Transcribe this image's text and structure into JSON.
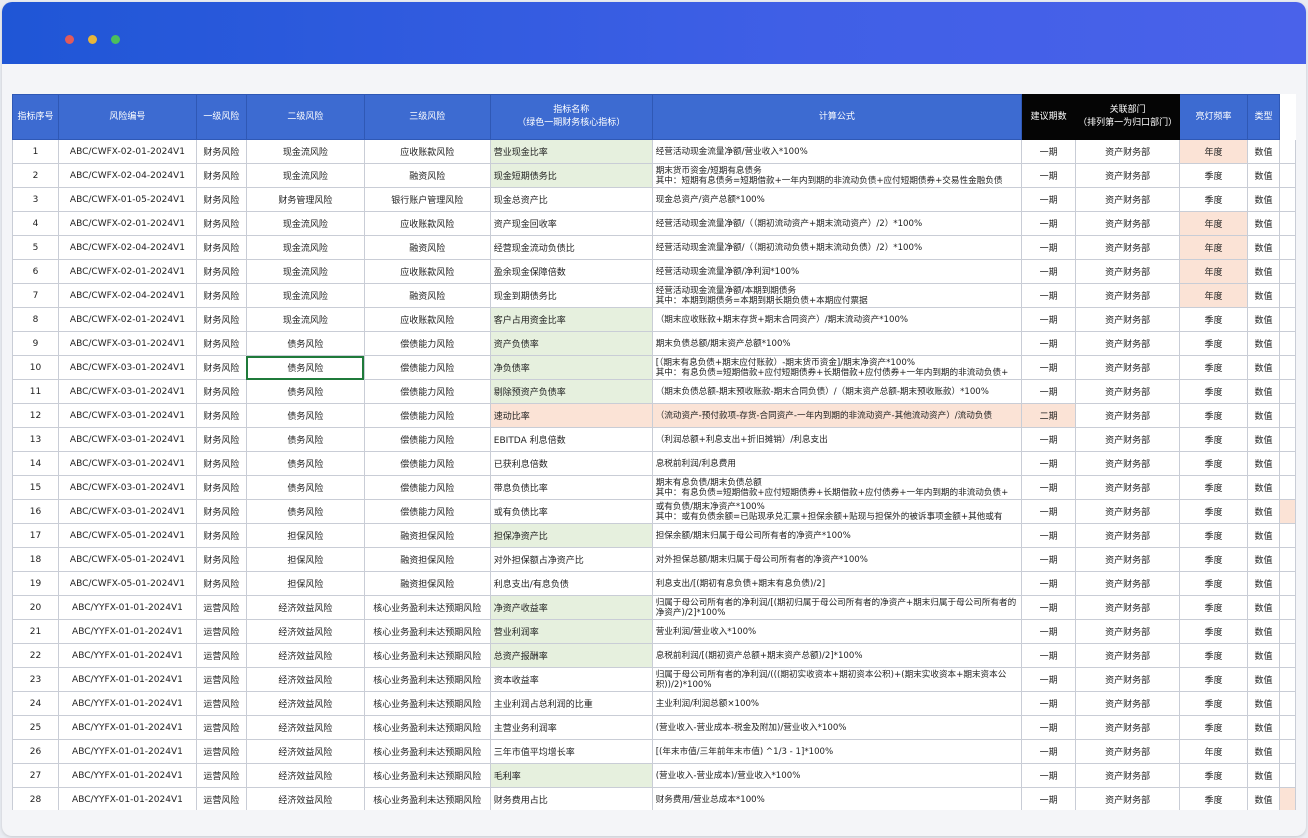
{
  "window": {
    "dots": [
      "#e25a5a",
      "#e8b53a",
      "#4bbf5c"
    ]
  },
  "headers": {
    "idx": "指标序号",
    "code": "风险编号",
    "l1": "一级风险",
    "l2": "二级风险",
    "l3": "三级风险",
    "name": "指标名称\n（绿色一期财务核心指标）",
    "formula": "计算公式",
    "period": "建议期数",
    "dept": "关联部门\n（排列第一为归口部门）",
    "freq": "亮灯频率",
    "type": "类型"
  },
  "rows": [
    {
      "idx": "1",
      "code": "ABC/CWFX-02-01-2024V1",
      "l1": "财务风险",
      "l2": "现金流风险",
      "l3": "应收账款风险",
      "name": "营业现金比率",
      "formula": "经营活动现金流量净额/营业收入*100%",
      "period": "一期",
      "dept": "资产财务部",
      "freq": "年度",
      "type": "数值",
      "green": true,
      "peach": true,
      "ext": false
    },
    {
      "idx": "2",
      "code": "ABC/CWFX-02-04-2024V1",
      "l1": "财务风险",
      "l2": "现金流风险",
      "l3": "融资风险",
      "name": "现金短期债务比",
      "formula": "期末货币资金/短期有息债务\n其中：短期有息债务=短期借款+一年内到期的非流动负债+应付短期债券+交易性金融负债",
      "period": "一期",
      "dept": "资产财务部",
      "freq": "季度",
      "type": "数值",
      "green": true,
      "peach": false,
      "ext": false
    },
    {
      "idx": "3",
      "code": "ABC/CWFX-01-05-2024V1",
      "l1": "财务风险",
      "l2": "财务管理风险",
      "l3": "银行账户管理风险",
      "name": "现金总资产比",
      "formula": "现金总资产/资产总额*100%",
      "period": "一期",
      "dept": "资产财务部",
      "freq": "季度",
      "type": "数值",
      "green": false,
      "peach": false,
      "ext": false
    },
    {
      "idx": "4",
      "code": "ABC/CWFX-02-01-2024V1",
      "l1": "财务风险",
      "l2": "现金流风险",
      "l3": "应收账款风险",
      "name": "资产现金回收率",
      "formula": "经营活动现金流量净额/（（期初流动资产+期末流动资产）/2）*100%",
      "period": "一期",
      "dept": "资产财务部",
      "freq": "年度",
      "type": "数值",
      "green": false,
      "peach": true,
      "ext": false
    },
    {
      "idx": "5",
      "code": "ABC/CWFX-02-04-2024V1",
      "l1": "财务风险",
      "l2": "现金流风险",
      "l3": "融资风险",
      "name": "经营现金流动负债比",
      "formula": "经营活动现金流量净额/（（期初流动负债+期末流动负债）/2）*100%",
      "period": "一期",
      "dept": "资产财务部",
      "freq": "年度",
      "type": "数值",
      "green": false,
      "peach": true,
      "ext": false
    },
    {
      "idx": "6",
      "code": "ABC/CWFX-02-01-2024V1",
      "l1": "财务风险",
      "l2": "现金流风险",
      "l3": "应收账款风险",
      "name": "盈余现金保障倍数",
      "formula": "经营活动现金流量净额/净利润*100%",
      "period": "一期",
      "dept": "资产财务部",
      "freq": "年度",
      "type": "数值",
      "green": false,
      "peach": true,
      "ext": false
    },
    {
      "idx": "7",
      "code": "ABC/CWFX-02-04-2024V1",
      "l1": "财务风险",
      "l2": "现金流风险",
      "l3": "融资风险",
      "name": "现金到期债务比",
      "formula": "经营活动现金流量净额/本期到期债务\n其中：本期到期债务=本期到期长期负债+本期应付票据",
      "period": "一期",
      "dept": "资产财务部",
      "freq": "年度",
      "type": "数值",
      "green": false,
      "peach": true,
      "ext": false
    },
    {
      "idx": "8",
      "code": "ABC/CWFX-02-01-2024V1",
      "l1": "财务风险",
      "l2": "现金流风险",
      "l3": "应收账款风险",
      "name": "客户占用资金比率",
      "formula": "（期末应收账款+期末存货+期末合同资产）/期末流动资产*100%",
      "period": "一期",
      "dept": "资产财务部",
      "freq": "季度",
      "type": "数值",
      "green": true,
      "peach": false,
      "ext": false
    },
    {
      "idx": "9",
      "code": "ABC/CWFX-03-01-2024V1",
      "l1": "财务风险",
      "l2": "债务风险",
      "l3": "偿债能力风险",
      "name": "资产负债率",
      "formula": "期末负债总额/期末资产总额*100%",
      "period": "一期",
      "dept": "资产财务部",
      "freq": "季度",
      "type": "数值",
      "green": true,
      "peach": false,
      "ext": false
    },
    {
      "idx": "10",
      "code": "ABC/CWFX-03-01-2024V1",
      "l1": "财务风险",
      "l2": "债务风险",
      "l3": "偿债能力风险",
      "name": "净负债率",
      "formula": "[（期末有息负债+期末应付账款）-期末货币资金]/期末净资产*100%\n其中：有息负债=短期借款+应付短期债券+长期借款+应付债券+一年内到期的非流动负债+",
      "period": "一期",
      "dept": "资产财务部",
      "freq": "季度",
      "type": "数值",
      "green": true,
      "peach": false,
      "ext": false,
      "sel": true
    },
    {
      "idx": "11",
      "code": "ABC/CWFX-03-01-2024V1",
      "l1": "财务风险",
      "l2": "债务风险",
      "l3": "偿债能力风险",
      "name": "剔除预资产负债率",
      "formula": "（期末负债总额-期末预收账款-期末合同负债）/（期末资产总额-期末预收账款）*100%",
      "period": "一期",
      "dept": "资产财务部",
      "freq": "季度",
      "type": "数值",
      "green": true,
      "peach": false,
      "ext": false
    },
    {
      "idx": "12",
      "code": "ABC/CWFX-03-01-2024V1",
      "l1": "财务风险",
      "l2": "债务风险",
      "l3": "偿债能力风险",
      "name": "速动比率",
      "formula": "（流动资产-预付款项-存货-合同资产-一年内到期的非流动资产-其他流动资产）/流动负债",
      "period": "二期",
      "dept": "资产财务部",
      "freq": "季度",
      "type": "数值",
      "green": false,
      "peach": false,
      "ext": false,
      "rowpeach": true
    },
    {
      "idx": "13",
      "code": "ABC/CWFX-03-01-2024V1",
      "l1": "财务风险",
      "l2": "债务风险",
      "l3": "偿债能力风险",
      "name": "EBITDA 利息倍数",
      "formula": "（利润总额+利息支出+折旧摊销）/利息支出",
      "period": "一期",
      "dept": "资产财务部",
      "freq": "季度",
      "type": "数值",
      "green": false,
      "peach": false,
      "ext": false
    },
    {
      "idx": "14",
      "code": "ABC/CWFX-03-01-2024V1",
      "l1": "财务风险",
      "l2": "债务风险",
      "l3": "偿债能力风险",
      "name": "已获利息倍数",
      "formula": "息税前利润/利息费用",
      "period": "一期",
      "dept": "资产财务部",
      "freq": "季度",
      "type": "数值",
      "green": false,
      "peach": false,
      "ext": false
    },
    {
      "idx": "15",
      "code": "ABC/CWFX-03-01-2024V1",
      "l1": "财务风险",
      "l2": "债务风险",
      "l3": "偿债能力风险",
      "name": "带息负债比率",
      "formula": "期末有息负债/期末负债总额\n其中：有息负债=短期借款+应付短期债券+长期借款+应付债券+一年内到期的非流动负债+",
      "period": "一期",
      "dept": "资产财务部",
      "freq": "季度",
      "type": "数值",
      "green": false,
      "peach": false,
      "ext": false
    },
    {
      "idx": "16",
      "code": "ABC/CWFX-03-01-2024V1",
      "l1": "财务风险",
      "l2": "债务风险",
      "l3": "偿债能力风险",
      "name": "或有负债比率",
      "formula": "或有负债/期末净资产*100%\n其中：或有负债余额=已贴现承兑汇票+担保余额+贴现与担保外的被诉事项金额+其他或有",
      "period": "一期",
      "dept": "资产财务部",
      "freq": "季度",
      "type": "数值",
      "green": false,
      "peach": false,
      "ext": true
    },
    {
      "idx": "17",
      "code": "ABC/CWFX-05-01-2024V1",
      "l1": "财务风险",
      "l2": "担保风险",
      "l3": "融资担保风险",
      "name": "担保净资产比",
      "formula": "担保余额/期末归属于母公司所有者的净资产*100%",
      "period": "一期",
      "dept": "资产财务部",
      "freq": "季度",
      "type": "数值",
      "green": true,
      "peach": false,
      "ext": false
    },
    {
      "idx": "18",
      "code": "ABC/CWFX-05-01-2024V1",
      "l1": "财务风险",
      "l2": "担保风险",
      "l3": "融资担保风险",
      "name": "对外担保额占净资产比",
      "formula": "对外担保总额/期末归属于母公司所有者的净资产*100%",
      "period": "一期",
      "dept": "资产财务部",
      "freq": "季度",
      "type": "数值",
      "green": false,
      "peach": false,
      "ext": false
    },
    {
      "idx": "19",
      "code": "ABC/CWFX-05-01-2024V1",
      "l1": "财务风险",
      "l2": "担保风险",
      "l3": "融资担保风险",
      "name": "利息支出/有息负债",
      "formula": "利息支出/[(期初有息负债+期末有息负债)/2]",
      "period": "一期",
      "dept": "资产财务部",
      "freq": "季度",
      "type": "数值",
      "green": false,
      "peach": false,
      "ext": false
    },
    {
      "idx": "20",
      "code": "ABC/YYFX-01-01-2024V1",
      "l1": "运营风险",
      "l2": "经济效益风险",
      "l3": "核心业务盈利未达预期风险",
      "name": "净资产收益率",
      "formula": "归属于母公司所有者的净利润/[(期初归属于母公司所有者的净资产+期末归属于母公司所有者的净资产)/2]*100%",
      "period": "一期",
      "dept": "资产财务部",
      "freq": "季度",
      "type": "数值",
      "green": true,
      "peach": false,
      "ext": false
    },
    {
      "idx": "21",
      "code": "ABC/YYFX-01-01-2024V1",
      "l1": "运营风险",
      "l2": "经济效益风险",
      "l3": "核心业务盈利未达预期风险",
      "name": "营业利润率",
      "formula": "营业利润/营业收入*100%",
      "period": "一期",
      "dept": "资产财务部",
      "freq": "季度",
      "type": "数值",
      "green": true,
      "peach": false,
      "ext": false
    },
    {
      "idx": "22",
      "code": "ABC/YYFX-01-01-2024V1",
      "l1": "运营风险",
      "l2": "经济效益风险",
      "l3": "核心业务盈利未达预期风险",
      "name": "总资产报酬率",
      "formula": "息税前利润/[(期初资产总额+期末资产总额)/2]*100%",
      "period": "一期",
      "dept": "资产财务部",
      "freq": "季度",
      "type": "数值",
      "green": true,
      "peach": false,
      "ext": false
    },
    {
      "idx": "23",
      "code": "ABC/YYFX-01-01-2024V1",
      "l1": "运营风险",
      "l2": "经济效益风险",
      "l3": "核心业务盈利未达预期风险",
      "name": "资本收益率",
      "formula": "归属于母公司所有者的净利润/(((期初实收资本+期初资本公积)+(期末实收资本+期末资本公积))/2)*100%",
      "period": "一期",
      "dept": "资产财务部",
      "freq": "季度",
      "type": "数值",
      "green": false,
      "peach": false,
      "ext": false
    },
    {
      "idx": "24",
      "code": "ABC/YYFX-01-01-2024V1",
      "l1": "运营风险",
      "l2": "经济效益风险",
      "l3": "核心业务盈利未达预期风险",
      "name": "主业利润占总利润的比重",
      "formula": "主业利润/利润总额×100%",
      "period": "一期",
      "dept": "资产财务部",
      "freq": "季度",
      "type": "数值",
      "green": false,
      "peach": false,
      "ext": false
    },
    {
      "idx": "25",
      "code": "ABC/YYFX-01-01-2024V1",
      "l1": "运营风险",
      "l2": "经济效益风险",
      "l3": "核心业务盈利未达预期风险",
      "name": "主营业务利润率",
      "formula": "(营业收入-营业成本-税金及附加)/营业收入*100%",
      "period": "一期",
      "dept": "资产财务部",
      "freq": "季度",
      "type": "数值",
      "green": false,
      "peach": false,
      "ext": false
    },
    {
      "idx": "26",
      "code": "ABC/YYFX-01-01-2024V1",
      "l1": "运营风险",
      "l2": "经济效益风险",
      "l3": "核心业务盈利未达预期风险",
      "name": "三年市值平均增长率",
      "formula": "[(年末市值/三年前年末市值) ^1/3 - 1]*100%",
      "period": "一期",
      "dept": "资产财务部",
      "freq": "年度",
      "type": "数值",
      "green": false,
      "peach": false,
      "ext": false
    },
    {
      "idx": "27",
      "code": "ABC/YYFX-01-01-2024V1",
      "l1": "运营风险",
      "l2": "经济效益风险",
      "l3": "核心业务盈利未达预期风险",
      "name": "毛利率",
      "formula": "(营业收入-营业成本)/营业收入*100%",
      "period": "一期",
      "dept": "资产财务部",
      "freq": "季度",
      "type": "数值",
      "green": true,
      "peach": false,
      "ext": false
    },
    {
      "idx": "28",
      "code": "ABC/YYFX-01-01-2024V1",
      "l1": "运营风险",
      "l2": "经济效益风险",
      "l3": "核心业务盈利未达预期风险",
      "name": "财务费用占比",
      "formula": "财务费用/营业总成本*100%",
      "period": "一期",
      "dept": "资产财务部",
      "freq": "季度",
      "type": "数值",
      "green": false,
      "peach": false,
      "ext": true
    }
  ]
}
